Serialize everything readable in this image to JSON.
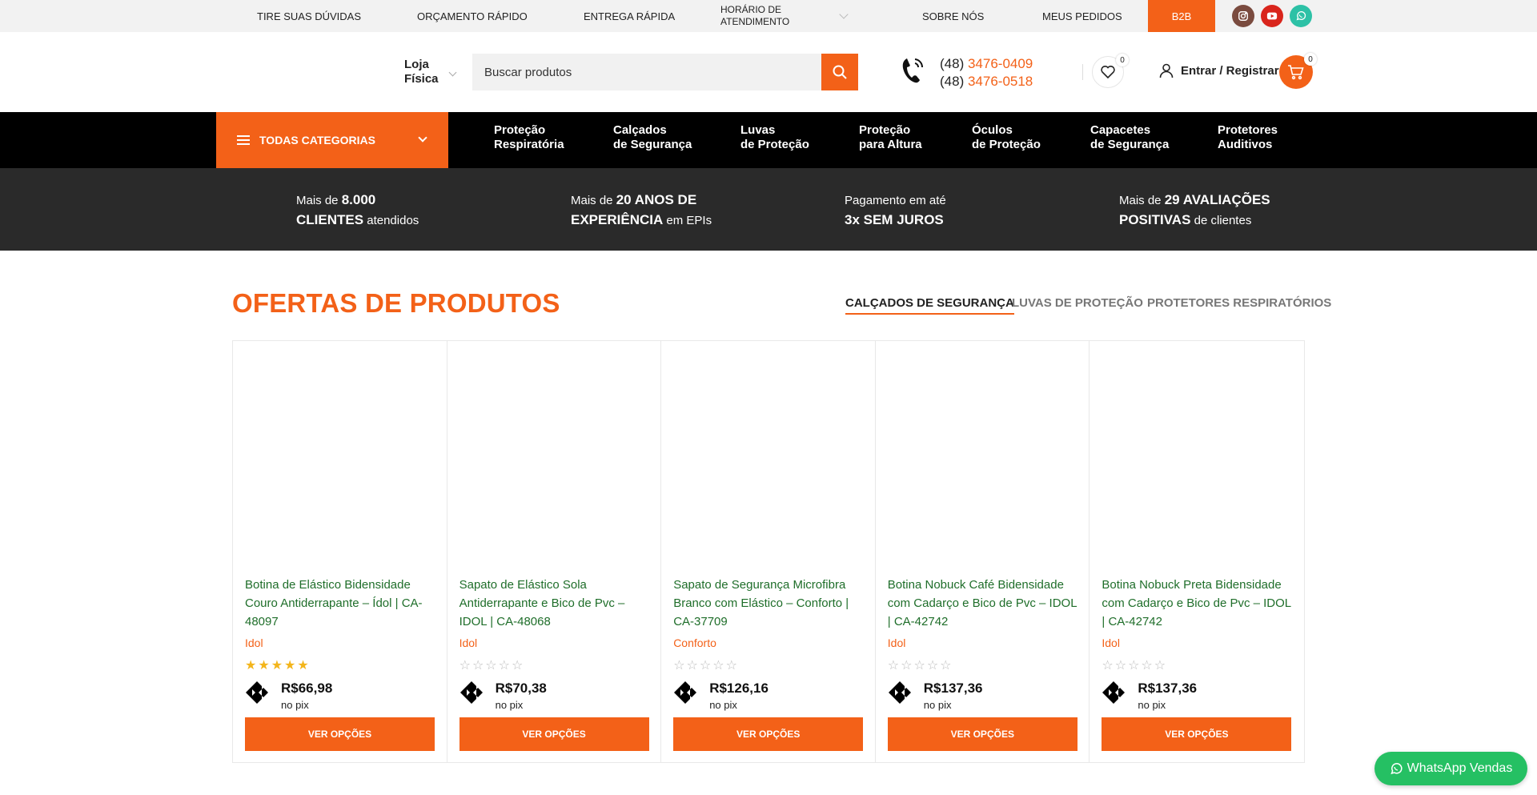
{
  "topbar": {
    "items": [
      "TIRE SUAS DÚVIDAS",
      "ORÇAMENTO RÁPIDO",
      "ENTREGA RÁPIDA"
    ],
    "hours": "HORÁRIO DE ATENDIMENTO",
    "about": "SOBRE NÓS",
    "orders": "MEUS PEDIDOS",
    "b2b": "B2B",
    "social": [
      {
        "icon": "instagram-icon",
        "color": "#7a4b3f"
      },
      {
        "icon": "youtube-icon",
        "color": "#d9251c"
      },
      {
        "icon": "whatsapp-icon",
        "color": "#2dc1a6"
      }
    ]
  },
  "header": {
    "store_line1": "Loja",
    "store_line2": "Física",
    "search_placeholder": "Buscar produtos",
    "phone1_prefix": "(48)",
    "phone1_number": "3476-0409",
    "phone2_prefix": "(48)",
    "phone2_number": "3476-0518",
    "wishlist_count": "0",
    "login_label": "Entrar / Registrar",
    "cart_count": "0"
  },
  "nav": {
    "all_categories": "TODAS CATEGORIAS",
    "links": [
      [
        "Proteção",
        "Respiratória"
      ],
      [
        "Calçados",
        "de Segurança"
      ],
      [
        "Luvas",
        "de Proteção"
      ],
      [
        "Proteção",
        "para Altura"
      ],
      [
        "Óculos",
        "de Proteção"
      ],
      [
        "Capacetes",
        "de Segurança"
      ],
      [
        "Protetores",
        "Auditivos"
      ]
    ]
  },
  "benefits": [
    {
      "a": "Mais de ",
      "b": "8.000",
      "c": "CLIENTES",
      "d": " atendidos"
    },
    {
      "a": "Mais de ",
      "b": "20 ANOS DE",
      "c": "EXPERIÊNCIA",
      "d": " em EPIs"
    },
    {
      "a": "Pagamento em até",
      "b": "",
      "c": "3x SEM JUROS",
      "d": ""
    },
    {
      "a": "Mais de ",
      "b": "29 AVALIAÇÕES",
      "c": "POSITIVAS",
      "d": " de clientes"
    }
  ],
  "offers": {
    "title": "OFERTAS DE PRODUTOS",
    "tabs": [
      "CALÇADOS DE SEGURANÇA",
      "LUVAS DE PROTEÇÃO",
      "PROTETORES RESPIRATÓRIOS"
    ],
    "products": [
      {
        "name": "Botina de Elástico Bidensidade Couro Antiderrapante – Ídol | CA-48097",
        "brand": "Idol",
        "rating": 5,
        "price": "R$66,98",
        "pix": "no pix",
        "button": "VER OPÇÕES"
      },
      {
        "name": "Sapato de Elástico Sola Antiderrapante e Bico de Pvc – IDOL | CA-48068",
        "brand": "Idol",
        "rating": 0,
        "price": "R$70,38",
        "pix": "no pix",
        "button": "VER OPÇÕES"
      },
      {
        "name": "Sapato de Segurança Microfibra Branco com Elástico – Conforto | CA-37709",
        "brand": "Conforto",
        "rating": 0,
        "price": "R$126,16",
        "pix": "no pix",
        "button": "VER OPÇÕES"
      },
      {
        "name": "Botina Nobuck Café Bidensidade com Cadarço e Bico de Pvc – IDOL | CA-42742",
        "brand": "Idol",
        "rating": 0,
        "price": "R$137,36",
        "pix": "no pix",
        "button": "VER OPÇÕES"
      },
      {
        "name": "Botina Nobuck Preta Bidensidade com Cadarço e Bico de Pvc – IDOL | CA-42742",
        "brand": "Idol",
        "rating": 0,
        "price": "R$137,36",
        "pix": "no pix",
        "button": "VER OPÇÕES"
      }
    ]
  },
  "whatsapp_button": "WhatsApp Vendas",
  "colors": {
    "accent": "#f36118",
    "dark": "#2a2a2a",
    "product_link": "#1f6e2a",
    "whatsapp": "#25c063"
  }
}
